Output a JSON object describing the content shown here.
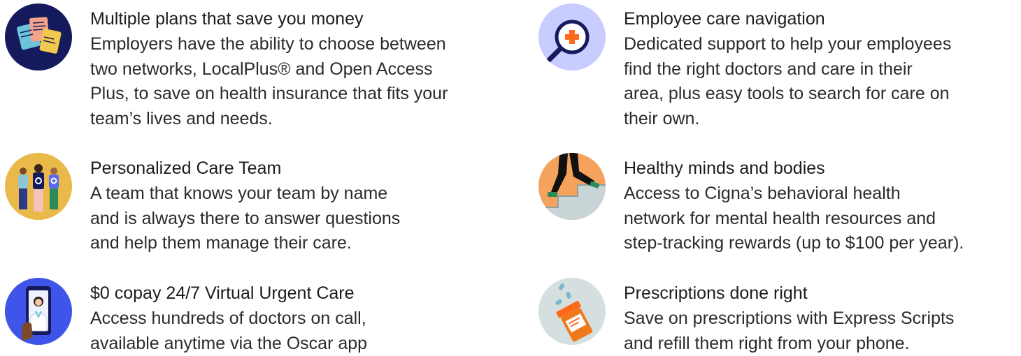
{
  "features": [
    {
      "icon": "insurance-cards-icon",
      "title": "Multiple plans that save you money",
      "description": "Employers have the ability to choose between\ntwo networks, LocalPlus® and Open Access\nPlus, to save on health insurance that fits your\nteam’s lives and needs."
    },
    {
      "icon": "care-navigation-magnifier-icon",
      "title": "Employee care navigation",
      "description": "Dedicated support to help your employees\nfind the right doctors and care in their\narea, plus easy tools to search for care on\ntheir own."
    },
    {
      "icon": "care-team-people-icon",
      "title": "Personalized Care Team",
      "description": "A team that knows your team by name\nand is always there to answer questions\nand help them manage their care."
    },
    {
      "icon": "walking-legs-stairs-icon",
      "title": "Healthy minds and bodies",
      "description": "Access to Cigna’s behavioral health\nnetwork for mental health resources and\nstep-tracking rewards (up to $100 per year)."
    },
    {
      "icon": "virtual-doctor-phone-icon",
      "title": "$0 copay 24/7 Virtual Urgent Care",
      "description": "Access hundreds of doctors on call,\navailable anytime via the Oscar app"
    },
    {
      "icon": "prescription-bottle-icon",
      "title": "Prescriptions done right",
      "description": "Save on prescriptions with Express Scripts\nand refill them right from your phone."
    }
  ],
  "colors": {
    "navy": "#141a5c",
    "lavender": "#c9ccff",
    "mustard": "#e9b949",
    "orange": "#f4a25c",
    "blue": "#3f54e8",
    "gray": "#d5dfe0",
    "accent_orange": "#ff6a1a"
  }
}
